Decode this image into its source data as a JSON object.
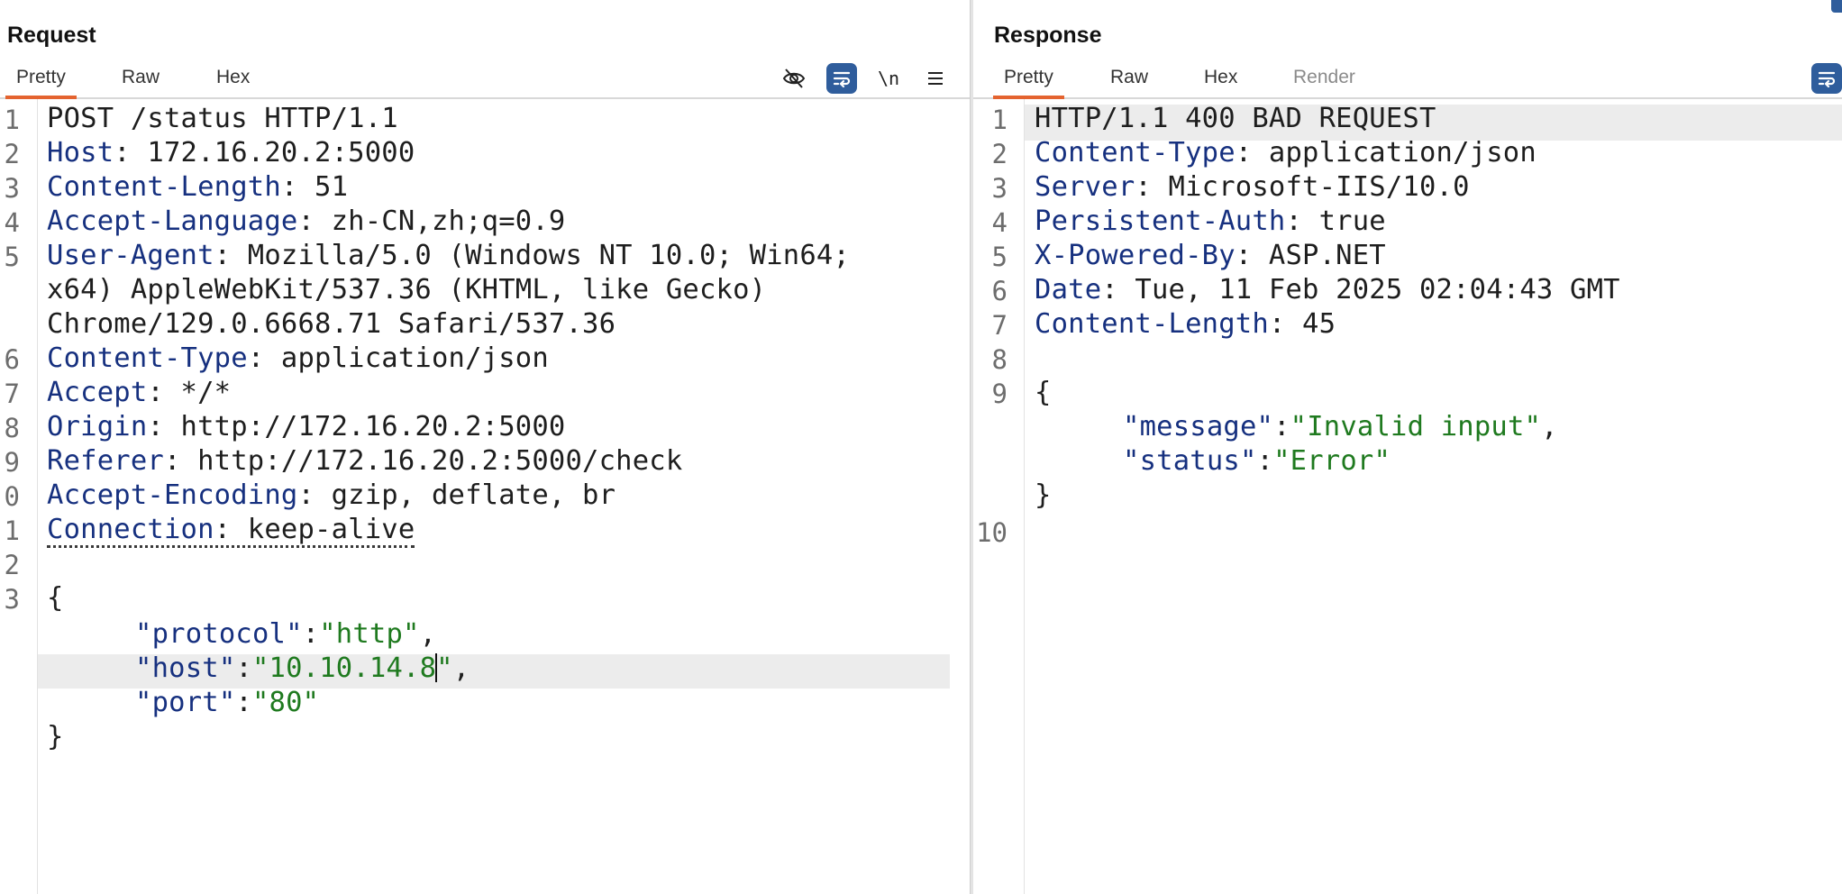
{
  "request": {
    "title": "Request",
    "tabs": [
      "Pretty",
      "Raw",
      "Hex"
    ],
    "tools": {
      "newline_label": "\\n"
    },
    "line_numbers": [
      "1",
      "2",
      "3",
      "4",
      "5",
      "6",
      "7",
      "8",
      "9",
      "0",
      "1",
      "2",
      "3"
    ],
    "lines": [
      {
        "text": "POST /status HTTP/1.1"
      },
      {
        "key": "Host",
        "sep": ": ",
        "val": "172.16.20.2:5000"
      },
      {
        "key": "Content-Length",
        "sep": ": ",
        "val": "51"
      },
      {
        "key": "Accept-Language",
        "sep": ": ",
        "val": "zh-CN,zh;q=0.9"
      },
      {
        "key": "User-Agent",
        "sep": ": ",
        "val": "Mozilla/5.0 (Windows NT 10.0; Win64;"
      },
      {
        "text": "x64) AppleWebKit/537.36 (KHTML, like Gecko)"
      },
      {
        "text": "Chrome/129.0.6668.71 Safari/537.36"
      },
      {
        "key": "Content-Type",
        "sep": ": ",
        "val": "application/json"
      },
      {
        "key": "Accept",
        "sep": ": ",
        "val": "*/*"
      },
      {
        "key": "Origin",
        "sep": ": ",
        "val": "http://172.16.20.2:5000"
      },
      {
        "key": "Referer",
        "sep": ": ",
        "val": "http://172.16.20.2:5000/check"
      },
      {
        "key": "Accept-Encoding",
        "sep": ": ",
        "val": "gzip, deflate, br"
      },
      {
        "key": "Connection",
        "sep": ": ",
        "val": "keep-alive"
      }
    ],
    "body": {
      "open": "{",
      "protocol_key": "\"protocol\"",
      "protocol_val": "\"http\"",
      "host_key": "\"host\"",
      "host_val_a": "\"10.10.14.8",
      "host_val_b": "\"",
      "port_key": "\"port\"",
      "port_val": "\"80\"",
      "close": "}"
    }
  },
  "response": {
    "title": "Response",
    "tabs": [
      "Pretty",
      "Raw",
      "Hex",
      "Render"
    ],
    "line_numbers": [
      "1",
      "2",
      "3",
      "4",
      "5",
      "6",
      "7",
      "8",
      "9",
      "10"
    ],
    "lines": [
      {
        "text": "HTTP/1.1 400 BAD REQUEST"
      },
      {
        "key": "Content-Type",
        "sep": ": ",
        "val": "application/json"
      },
      {
        "key": "Server",
        "sep": ": ",
        "val": "Microsoft-IIS/10.0"
      },
      {
        "key": "Persistent-Auth",
        "sep": ": ",
        "val": "true"
      },
      {
        "key": "X-Powered-By",
        "sep": ": ",
        "val": "ASP.NET"
      },
      {
        "key": "Date",
        "sep": ": ",
        "val": "Tue, 11 Feb 2025 02:04:43 GMT"
      },
      {
        "key": "Content-Length",
        "sep": ": ",
        "val": "45"
      }
    ],
    "body": {
      "open": "{",
      "message_key": "\"message\"",
      "message_val": "\"Invalid input\"",
      "status_key": "\"status\"",
      "status_val": "\"Error\"",
      "close": "}"
    }
  },
  "colors": {
    "accent_tab": "#e4632f",
    "tool_active": "#2f5d9c",
    "header_key": "#16307f",
    "json_string": "#1f7a1f"
  }
}
